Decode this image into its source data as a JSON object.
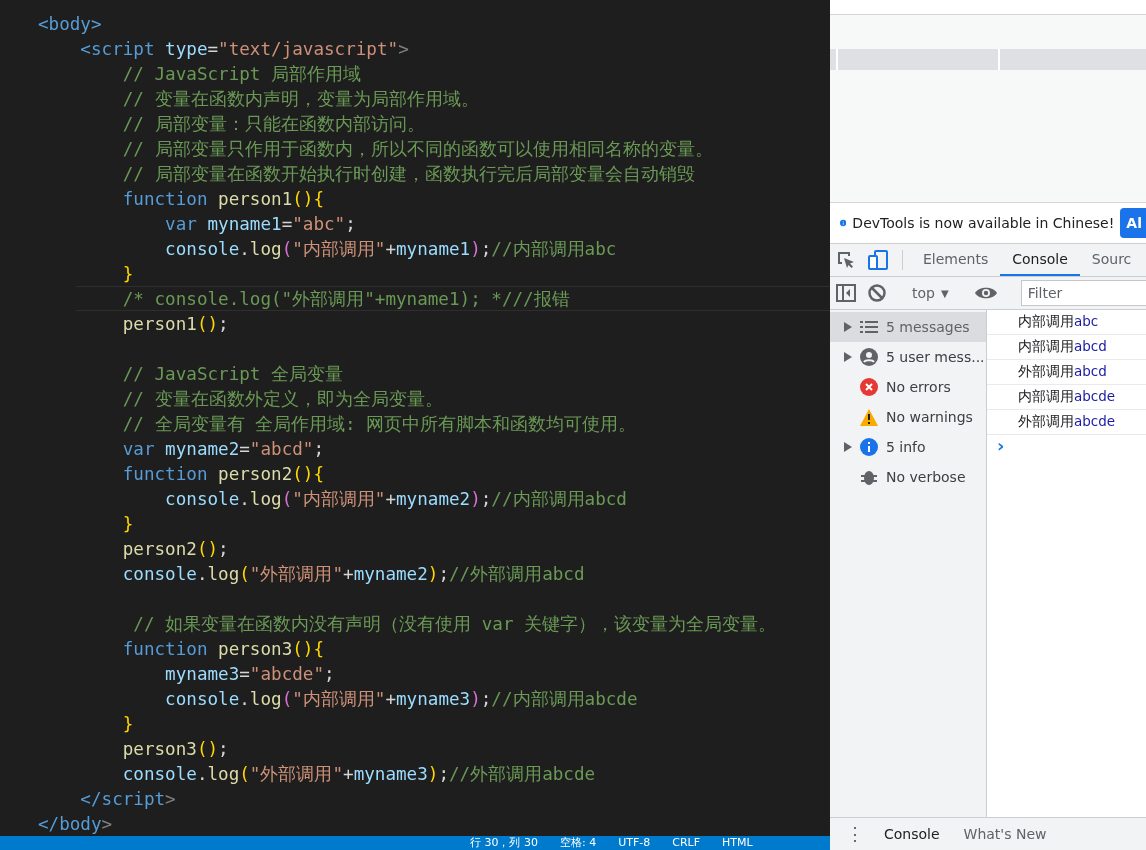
{
  "editor": {
    "lines": [
      {
        "current": false,
        "tokens": [
          {
            "kind": "tag",
            "text": "<body>"
          }
        ]
      },
      {
        "current": false,
        "tokens": [
          {
            "kind": "tag",
            "text": "    <script "
          },
          {
            "kind": "attr",
            "text": "type"
          },
          {
            "kind": "punct",
            "text": "="
          },
          {
            "kind": "string",
            "text": "\"text/javascript\""
          },
          {
            "kind": "tagend",
            "text": ">"
          }
        ]
      },
      {
        "current": false,
        "tokens": [
          {
            "kind": "comment",
            "text": "        // JavaScript 局部作用域"
          }
        ]
      },
      {
        "current": false,
        "tokens": [
          {
            "kind": "comment",
            "text": "        // 变量在函数内声明，变量为局部作用域。"
          }
        ]
      },
      {
        "current": false,
        "tokens": [
          {
            "kind": "comment",
            "text": "        // 局部变量：只能在函数内部访问。"
          }
        ]
      },
      {
        "current": false,
        "tokens": [
          {
            "kind": "comment",
            "text": "        // 局部变量只作用于函数内，所以不同的函数可以使用相同名称的变量。"
          }
        ]
      },
      {
        "current": false,
        "tokens": [
          {
            "kind": "comment",
            "text": "        // 局部变量在函数开始执行时创建，函数执行完后局部变量会自动销毁"
          }
        ]
      },
      {
        "current": false,
        "tokens": [
          {
            "kind": "keyword",
            "text": "        function "
          },
          {
            "kind": "func",
            "text": "person1"
          },
          {
            "kind": "bracket",
            "text": "(){"
          }
        ]
      },
      {
        "current": false,
        "tokens": [
          {
            "kind": "keyword",
            "text": "            var "
          },
          {
            "kind": "variable",
            "text": "myname1"
          },
          {
            "kind": "punct",
            "text": "="
          },
          {
            "kind": "string",
            "text": "\"abc\""
          },
          {
            "kind": "punct",
            "text": ";"
          }
        ]
      },
      {
        "current": false,
        "tokens": [
          {
            "kind": "variable",
            "text": "            console"
          },
          {
            "kind": "punct",
            "text": "."
          },
          {
            "kind": "func",
            "text": "log"
          },
          {
            "kind": "bracket2",
            "text": "("
          },
          {
            "kind": "string",
            "text": "\"内部调用\""
          },
          {
            "kind": "punct",
            "text": "+"
          },
          {
            "kind": "variable",
            "text": "myname1"
          },
          {
            "kind": "bracket2",
            "text": ")"
          },
          {
            "kind": "punct",
            "text": ";"
          },
          {
            "kind": "comment",
            "text": "//内部调用abc"
          }
        ]
      },
      {
        "current": false,
        "tokens": [
          {
            "kind": "bracket",
            "text": "        }"
          }
        ]
      },
      {
        "current": true,
        "tokens": [
          {
            "kind": "comment",
            "text": "        /* console.log(\"外部调用\"+myname1); *///报错"
          }
        ]
      },
      {
        "current": false,
        "tokens": [
          {
            "kind": "func",
            "text": "        person1"
          },
          {
            "kind": "bracket",
            "text": "()"
          },
          {
            "kind": "punct",
            "text": ";"
          }
        ]
      },
      {
        "current": false
      },
      {
        "current": false,
        "tokens": [
          {
            "kind": "comment",
            "text": "        // JavaScript 全局变量"
          }
        ]
      },
      {
        "current": false,
        "tokens": [
          {
            "kind": "comment",
            "text": "        // 变量在函数外定义，即为全局变量。"
          }
        ]
      },
      {
        "current": false,
        "tokens": [
          {
            "kind": "comment",
            "text": "        // 全局变量有 全局作用域: 网页中所有脚本和函数均可使用。"
          }
        ]
      },
      {
        "current": false,
        "tokens": [
          {
            "kind": "keyword",
            "text": "        var "
          },
          {
            "kind": "variable",
            "text": "myname2"
          },
          {
            "kind": "punct",
            "text": "="
          },
          {
            "kind": "string",
            "text": "\"abcd\""
          },
          {
            "kind": "punct",
            "text": ";"
          }
        ]
      },
      {
        "current": false,
        "tokens": [
          {
            "kind": "keyword",
            "text": "        function "
          },
          {
            "kind": "func",
            "text": "person2"
          },
          {
            "kind": "bracket",
            "text": "(){"
          }
        ]
      },
      {
        "current": false,
        "tokens": [
          {
            "kind": "variable",
            "text": "            console"
          },
          {
            "kind": "punct",
            "text": "."
          },
          {
            "kind": "func",
            "text": "log"
          },
          {
            "kind": "bracket2",
            "text": "("
          },
          {
            "kind": "string",
            "text": "\"内部调用\""
          },
          {
            "kind": "punct",
            "text": "+"
          },
          {
            "kind": "variable",
            "text": "myname2"
          },
          {
            "kind": "bracket2",
            "text": ")"
          },
          {
            "kind": "punct",
            "text": ";"
          },
          {
            "kind": "comment",
            "text": "//内部调用abcd"
          }
        ]
      },
      {
        "current": false,
        "tokens": [
          {
            "kind": "bracket",
            "text": "        }"
          }
        ]
      },
      {
        "current": false,
        "tokens": [
          {
            "kind": "func",
            "text": "        person2"
          },
          {
            "kind": "bracket",
            "text": "()"
          },
          {
            "kind": "punct",
            "text": ";"
          }
        ]
      },
      {
        "current": false,
        "tokens": [
          {
            "kind": "variable",
            "text": "        console"
          },
          {
            "kind": "punct",
            "text": "."
          },
          {
            "kind": "func",
            "text": "log"
          },
          {
            "kind": "bracket",
            "text": "("
          },
          {
            "kind": "string",
            "text": "\"外部调用\""
          },
          {
            "kind": "punct",
            "text": "+"
          },
          {
            "kind": "variable",
            "text": "myname2"
          },
          {
            "kind": "bracket",
            "text": ")"
          },
          {
            "kind": "punct",
            "text": ";"
          },
          {
            "kind": "comment",
            "text": "//外部调用abcd"
          }
        ]
      },
      {
        "current": false
      },
      {
        "current": false,
        "tokens": [
          {
            "kind": "comment",
            "text": "         // 如果变量在函数内没有声明（没有使用 var 关键字），该变量为全局变量。"
          }
        ]
      },
      {
        "current": false,
        "tokens": [
          {
            "kind": "keyword",
            "text": "        function "
          },
          {
            "kind": "func",
            "text": "person3"
          },
          {
            "kind": "bracket",
            "text": "(){"
          }
        ]
      },
      {
        "current": false,
        "tokens": [
          {
            "kind": "variable",
            "text": "            myname3"
          },
          {
            "kind": "punct",
            "text": "="
          },
          {
            "kind": "string",
            "text": "\"abcde\""
          },
          {
            "kind": "punct",
            "text": ";"
          }
        ]
      },
      {
        "current": false,
        "tokens": [
          {
            "kind": "variable",
            "text": "            console"
          },
          {
            "kind": "punct",
            "text": "."
          },
          {
            "kind": "func",
            "text": "log"
          },
          {
            "kind": "bracket2",
            "text": "("
          },
          {
            "kind": "string",
            "text": "\"内部调用\""
          },
          {
            "kind": "punct",
            "text": "+"
          },
          {
            "kind": "variable",
            "text": "myname3"
          },
          {
            "kind": "bracket2",
            "text": ")"
          },
          {
            "kind": "punct",
            "text": ";"
          },
          {
            "kind": "comment",
            "text": "//内部调用abcde"
          }
        ]
      },
      {
        "current": false,
        "tokens": [
          {
            "kind": "bracket",
            "text": "        }"
          }
        ]
      },
      {
        "current": false,
        "tokens": [
          {
            "kind": "func",
            "text": "        person3"
          },
          {
            "kind": "bracket",
            "text": "()"
          },
          {
            "kind": "punct",
            "text": ";"
          }
        ]
      },
      {
        "current": false,
        "tokens": [
          {
            "kind": "variable",
            "text": "        console"
          },
          {
            "kind": "punct",
            "text": "."
          },
          {
            "kind": "func",
            "text": "log"
          },
          {
            "kind": "bracket",
            "text": "("
          },
          {
            "kind": "string",
            "text": "\"外部调用\""
          },
          {
            "kind": "punct",
            "text": "+"
          },
          {
            "kind": "variable",
            "text": "myname3"
          },
          {
            "kind": "bracket",
            "text": ")"
          },
          {
            "kind": "punct",
            "text": ";"
          },
          {
            "kind": "comment",
            "text": "//外部调用abcde"
          }
        ]
      },
      {
        "current": false,
        "tokens": [
          {
            "kind": "tag",
            "text": "    </script"
          },
          {
            "kind": "tagend",
            "text": ">"
          }
        ]
      },
      {
        "current": false,
        "tokens": [
          {
            "kind": "tag",
            "text": "</body"
          },
          {
            "kind": "tagend",
            "text": ">"
          }
        ]
      }
    ]
  },
  "status_bar": [
    "行 30，列 30",
    "空格: 4",
    "UTF-8",
    "CRLF",
    "HTML"
  ],
  "devtools": {
    "banner": {
      "text": "DevTools is now available in Chinese!",
      "button": "Al"
    },
    "tabs": [
      {
        "label": "Elements",
        "selected": false
      },
      {
        "label": "Console",
        "selected": true
      },
      {
        "label": "Sourc",
        "selected": false
      }
    ],
    "context": "top",
    "context_caret": "▼",
    "filter": {
      "placeholder": "Filter"
    },
    "sidebar": [
      {
        "kind": "list",
        "label": "5 messages",
        "expandable": true,
        "selected": true
      },
      {
        "kind": "user",
        "label": "5 user mess...",
        "expandable": true,
        "selected": false
      },
      {
        "kind": "error",
        "label": "No errors",
        "expandable": false,
        "selected": false
      },
      {
        "kind": "warning",
        "label": "No warnings",
        "expandable": false,
        "selected": false
      },
      {
        "kind": "info",
        "label": "5 info",
        "expandable": true,
        "selected": false
      },
      {
        "kind": "verbose",
        "label": "No verbose",
        "expandable": false,
        "selected": false
      }
    ],
    "messages": [
      {
        "text": "内部调用",
        "value": "abc"
      },
      {
        "text": "内部调用",
        "value": "abcd"
      },
      {
        "text": "外部调用",
        "value": "abcd"
      },
      {
        "text": "内部调用",
        "value": "abcde"
      },
      {
        "text": "外部调用",
        "value": "abcde"
      }
    ],
    "prompt": "›",
    "drawer": {
      "menu": "⋮",
      "tabs": [
        {
          "label": "Console",
          "selected": true
        },
        {
          "label": "What's New",
          "selected": false
        }
      ]
    }
  }
}
